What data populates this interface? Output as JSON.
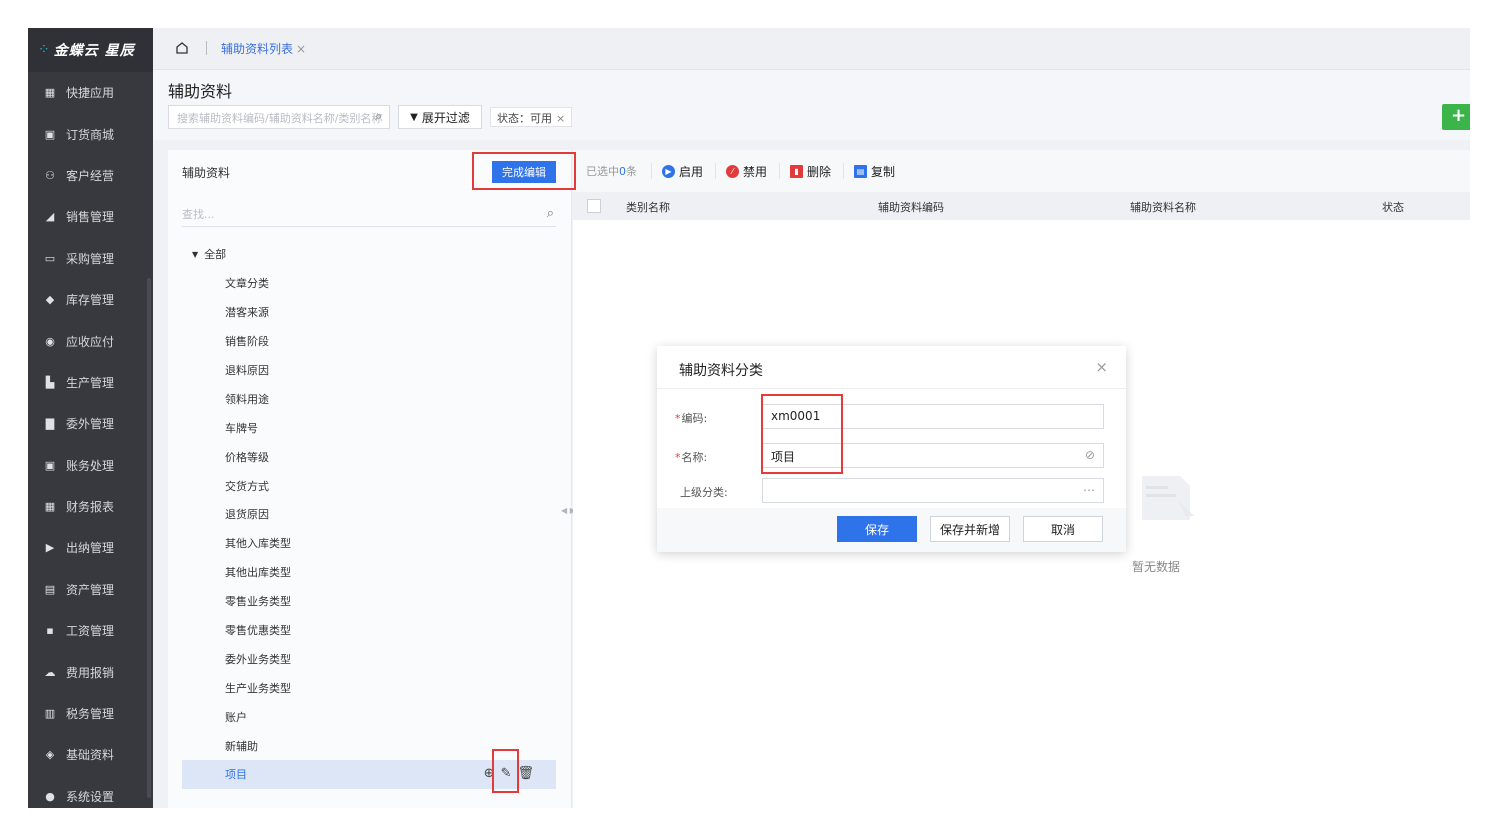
{
  "app": {
    "logo_text": "金蝶云 星辰"
  },
  "sidebar": {
    "items": [
      {
        "label": "快捷应用",
        "icon": "grid-icon"
      },
      {
        "label": "订货商城",
        "icon": "bag-icon"
      },
      {
        "label": "客户经营",
        "icon": "user-icon"
      },
      {
        "label": "销售管理",
        "icon": "chart-icon"
      },
      {
        "label": "采购管理",
        "icon": "cart-icon"
      },
      {
        "label": "库存管理",
        "icon": "box-icon"
      },
      {
        "label": "应收应付",
        "icon": "target-icon"
      },
      {
        "label": "生产管理",
        "icon": "factory-icon"
      },
      {
        "label": "委外管理",
        "icon": "outsource-icon"
      },
      {
        "label": "账务处理",
        "icon": "ledger-icon"
      },
      {
        "label": "财务报表",
        "icon": "calculator-icon"
      },
      {
        "label": "出纳管理",
        "icon": "cashier-icon"
      },
      {
        "label": "资产管理",
        "icon": "asset-icon"
      },
      {
        "label": "工资管理",
        "icon": "wallet-icon"
      },
      {
        "label": "费用报销",
        "icon": "cloud-icon"
      },
      {
        "label": "税务管理",
        "icon": "tax-icon"
      },
      {
        "label": "基础资料",
        "icon": "layers-icon"
      },
      {
        "label": "系统设置",
        "icon": "settings-icon"
      }
    ]
  },
  "topbar": {
    "tab_label": "辅助资料列表",
    "tab_close": "×"
  },
  "page": {
    "title": "辅助资料",
    "search_placeholder": "搜索辅助资料编码/辅助资料名称/类别名称",
    "filter_label": "展开过滤",
    "status_chip": "状态：可用",
    "chip_close": "×",
    "add_label": "+"
  },
  "left_panel": {
    "title": "辅助资料",
    "done_button": "完成编辑",
    "search_placeholder": "查找...",
    "root_label": "全部",
    "nodes": [
      "文章分类",
      "潜客来源",
      "销售阶段",
      "退料原因",
      "领料用途",
      "车牌号",
      "价格等级",
      "交货方式",
      "退货原因",
      "其他入库类型",
      "其他出库类型",
      "零售业务类型",
      "零售优惠类型",
      "委外业务类型",
      "生产业务类型",
      "账户",
      "新辅助",
      "项目"
    ]
  },
  "toolbar": {
    "selected_prefix": "已选中",
    "selected_count": "0",
    "selected_suffix": "条",
    "enable_label": "启用",
    "disable_label": "禁用",
    "delete_label": "删除",
    "copy_label": "复制"
  },
  "table": {
    "columns": [
      "类别名称",
      "辅助资料编码",
      "辅助资料名称",
      "状态"
    ],
    "empty_text": "暂无数据"
  },
  "dialog": {
    "title": "辅助资料分类",
    "close": "×",
    "code_label": "编码:",
    "code_value": "xm0001",
    "name_label": "名称:",
    "name_value": "项目",
    "parent_label": "上级分类:",
    "parent_value": "",
    "save": "保存",
    "save_and_new": "保存并新增",
    "cancel": "取消",
    "required_mark": "*"
  },
  "colors": {
    "primary": "#2e73ea",
    "highlight": "#e43a3a",
    "sidebar_bg": "#37393e",
    "add_green": "#3bb54a"
  }
}
